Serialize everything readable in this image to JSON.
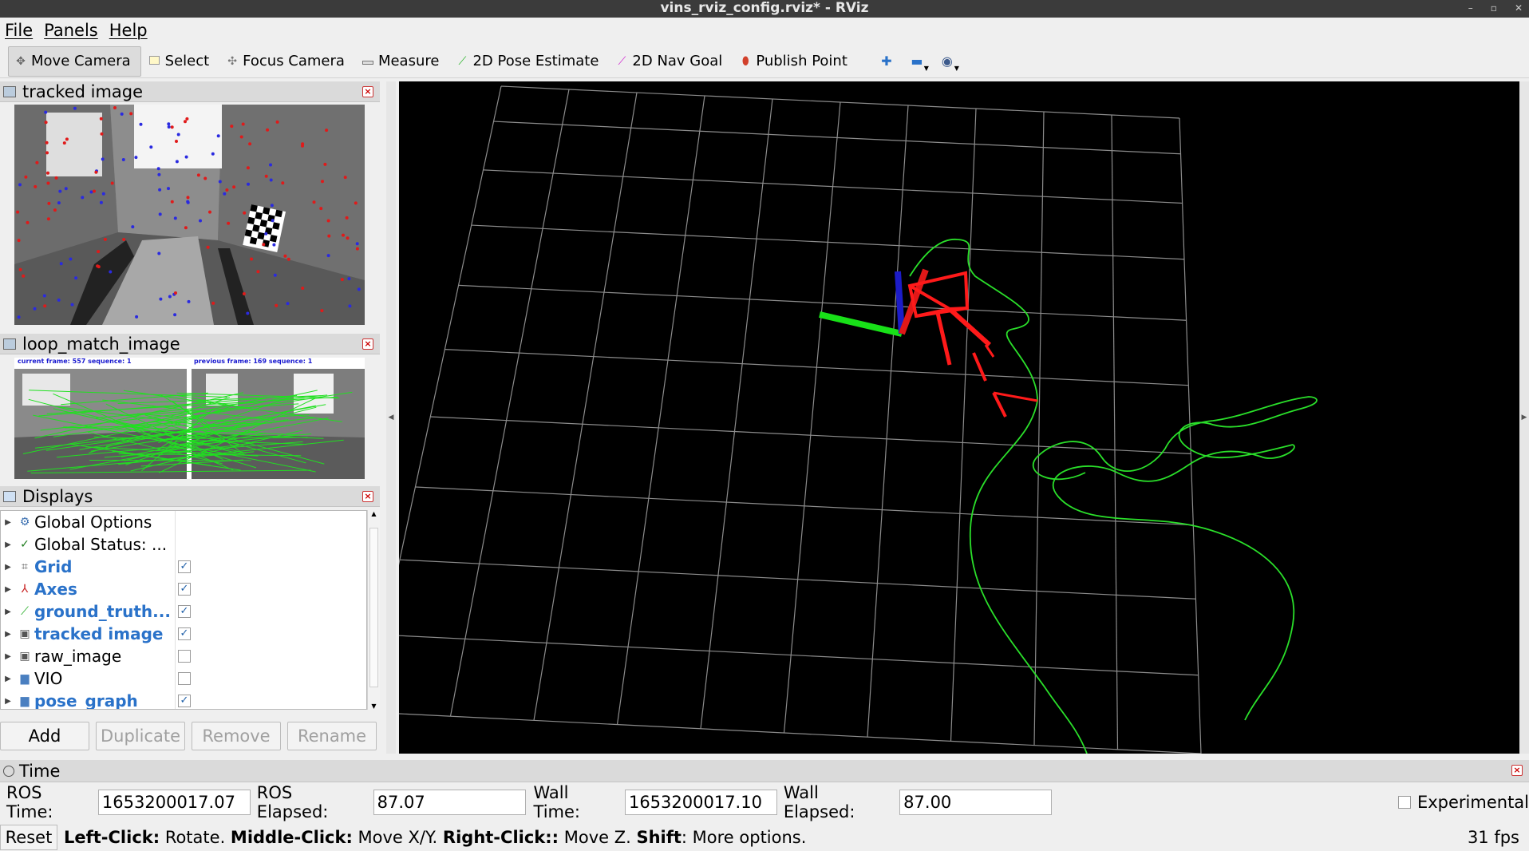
{
  "window": {
    "title": "vins_rviz_config.rviz* - RViz"
  },
  "menu": [
    "File",
    "Panels",
    "Help"
  ],
  "toolbar": {
    "tools": [
      {
        "label": "Move Camera",
        "icon": "move-camera-icon",
        "active": true
      },
      {
        "label": "Select",
        "icon": "select-icon"
      },
      {
        "label": "Focus Camera",
        "icon": "focus-camera-icon"
      },
      {
        "label": "Measure",
        "icon": "measure-icon"
      },
      {
        "label": "2D Pose Estimate",
        "icon": "pose-estimate-icon"
      },
      {
        "label": "2D Nav Goal",
        "icon": "nav-goal-icon"
      },
      {
        "label": "Publish Point",
        "icon": "publish-point-icon"
      }
    ]
  },
  "panels": {
    "tracked": {
      "title": "tracked image"
    },
    "loop": {
      "title": "loop_match_image",
      "current_caption": "current frame: 557   sequence: 1",
      "previous_caption": "previous frame: 169   sequence: 1"
    },
    "displays": {
      "title": "Displays",
      "items": [
        {
          "label": "Global Options",
          "bold": false,
          "checkbox": false,
          "icon": "gear-icon"
        },
        {
          "label": "Global Status: ...",
          "bold": false,
          "checkbox": false,
          "icon": "checkmark-icon"
        },
        {
          "label": "Grid",
          "bold": true,
          "checkbox": true,
          "checked": true,
          "icon": "grid-icon"
        },
        {
          "label": "Axes",
          "bold": true,
          "checkbox": true,
          "checked": true,
          "icon": "axes-icon"
        },
        {
          "label": "ground_truth...",
          "bold": true,
          "checkbox": true,
          "checked": true,
          "icon": "path-icon"
        },
        {
          "label": "tracked image",
          "bold": true,
          "checkbox": true,
          "checked": true,
          "icon": "image-icon"
        },
        {
          "label": "raw_image",
          "bold": false,
          "checkbox": true,
          "checked": false,
          "icon": "image-icon"
        },
        {
          "label": "VIO",
          "bold": false,
          "checkbox": true,
          "checked": false,
          "icon": "folder-icon"
        },
        {
          "label": "pose_graph",
          "bold": true,
          "checkbox": true,
          "checked": true,
          "icon": "folder-icon"
        }
      ],
      "buttons": {
        "add": "Add",
        "duplicate": "Duplicate",
        "remove": "Remove",
        "rename": "Rename"
      }
    }
  },
  "time": {
    "title": "Time",
    "ros_time_label": "ROS Time:",
    "ros_time": "1653200017.07",
    "ros_elapsed_label": "ROS Elapsed:",
    "ros_elapsed": "87.07",
    "wall_time_label": "Wall Time:",
    "wall_time": "1653200017.10",
    "wall_elapsed_label": "Wall Elapsed:",
    "wall_elapsed": "87.00",
    "experimental_label": "Experimental"
  },
  "status": {
    "reset": "Reset",
    "left_click": "Left-Click:",
    "left_click_desc": " Rotate. ",
    "middle_click": "Middle-Click:",
    "middle_click_desc": " Move X/Y. ",
    "right_click": "Right-Click::",
    "right_click_desc": " Move Z. ",
    "shift": "Shift",
    "shift_desc": ": More options.",
    "fps": "31 fps"
  },
  "colors": {
    "accent": "#2a72c9",
    "trajectory": "#2adf2a",
    "camera_frustum": "#ff1a1a"
  }
}
